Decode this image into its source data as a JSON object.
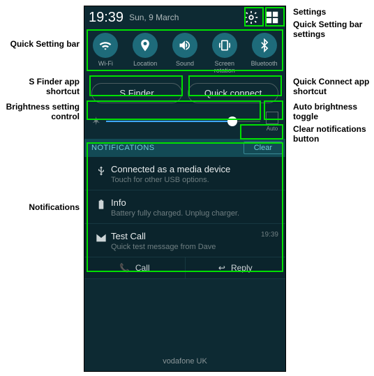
{
  "status": {
    "time": "19:39",
    "date": "Sun, 9 March"
  },
  "qs": [
    {
      "label": "Wi-Fi"
    },
    {
      "label": "Location"
    },
    {
      "label": "Sound"
    },
    {
      "label": "Screen\nrotation"
    },
    {
      "label": "Bluetooth"
    }
  ],
  "shortcuts": {
    "sfinder": "S Finder",
    "quickconnect": "Quick connect"
  },
  "brightness": {
    "auto": "Auto"
  },
  "notif_header": {
    "title": "NOTIFICATIONS",
    "clear": "Clear"
  },
  "notifs": [
    {
      "title": "Connected as a media device",
      "sub": "Touch for other USB options.",
      "time": ""
    },
    {
      "title": "Info",
      "sub": "Battery fully charged. Unplug charger.",
      "time": ""
    },
    {
      "title": "Test Call",
      "sub": "Quick test message from Dave",
      "time": "19:39"
    }
  ],
  "actions": {
    "call": "Call",
    "reply": "Reply"
  },
  "carrier": "vodafone UK",
  "callouts": {
    "settings": "Settings",
    "qsbar_settings": "Quick Setting bar settings",
    "qsbar": "Quick Setting bar",
    "sfinder": "S Finder app shortcut",
    "quickconnect": "Quick Connect app shortcut",
    "brightness": "Brightness setting control",
    "auto": "Auto brightness toggle",
    "notif_clear": "Clear notifications button",
    "notifications": "Notifications"
  }
}
